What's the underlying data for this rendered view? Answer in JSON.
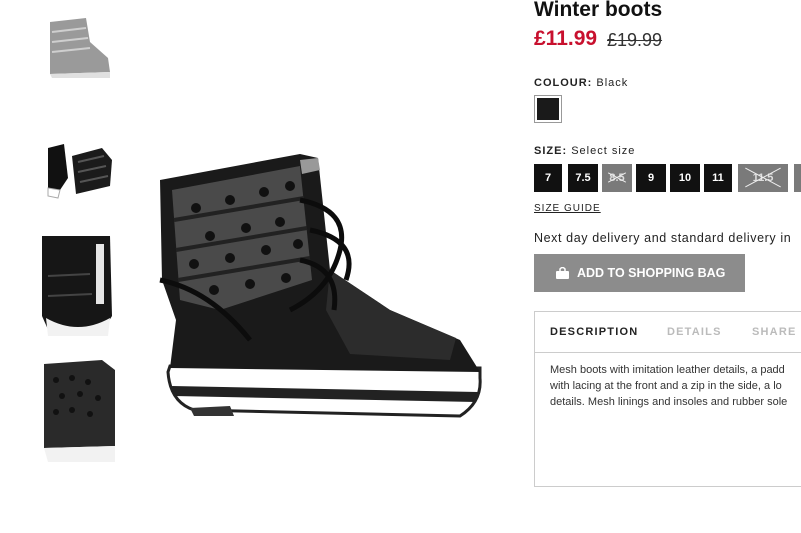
{
  "product": {
    "title": "Winter boots",
    "price": "£11.99",
    "old_price": "£19.99"
  },
  "colour": {
    "label": "COLOUR:",
    "value": "Black"
  },
  "size": {
    "label": "SIZE:",
    "placeholder": "Select size",
    "options": [
      {
        "label": "7",
        "available": true
      },
      {
        "label": "7.5",
        "available": true
      },
      {
        "label": "8.5",
        "available": false
      },
      {
        "label": "9",
        "available": true
      },
      {
        "label": "10",
        "available": true
      },
      {
        "label": "11",
        "available": true
      },
      {
        "label": "11.5",
        "available": false
      }
    ],
    "guide_link": "SIZE GUIDE"
  },
  "delivery_text": "Next day delivery and standard delivery in",
  "add_button": "ADD TO SHOPPING BAG",
  "tabs": {
    "description": "DESCRIPTION",
    "details": "DETAILS",
    "share": "SHARE"
  },
  "description_lines": [
    "Mesh boots with imitation leather details, a padd",
    "with lacing at the front and a zip in the side, a lo",
    "details. Mesh linings and insoles and rubber sole"
  ],
  "colors": {
    "sale": "#c8102e",
    "button": "#8c8c8c"
  }
}
